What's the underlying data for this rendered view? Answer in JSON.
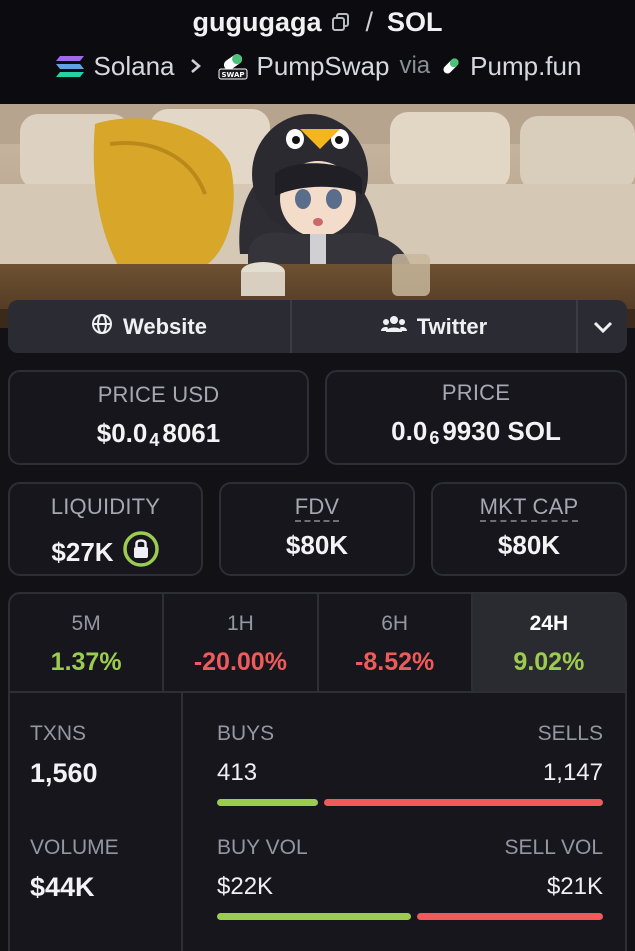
{
  "header": {
    "token_name": "gugugaga",
    "quote": "SOL",
    "chain": "Solana",
    "dex": "PumpSwap",
    "via": "via",
    "launchpad": "Pump.fun",
    "swap_badge": "SWAP"
  },
  "links": {
    "website": "Website",
    "twitter": "Twitter"
  },
  "price_usd": {
    "label": "PRICE USD",
    "prefix": "$0.0",
    "zeros": "4",
    "digits": "8061"
  },
  "price_native": {
    "label": "PRICE",
    "prefix": "0.0",
    "zeros": "6",
    "digits": "9930 SOL"
  },
  "liquidity": {
    "label": "LIQUIDITY",
    "value": "$27K"
  },
  "fdv": {
    "label": "FDV",
    "value": "$80K"
  },
  "mkt_cap": {
    "label": "MKT CAP",
    "value": "$80K"
  },
  "timeframes": [
    {
      "label": "5M",
      "change": "1.37%",
      "dir": "up"
    },
    {
      "label": "1H",
      "change": "-20.00%",
      "dir": "down"
    },
    {
      "label": "6H",
      "change": "-8.52%",
      "dir": "down"
    },
    {
      "label": "24H",
      "change": "9.02%",
      "dir": "up",
      "selected": true
    }
  ],
  "txns": {
    "label": "TXNS",
    "value": "1,560"
  },
  "volume": {
    "label": "VOLUME",
    "value": "$44K"
  },
  "buys": {
    "label": "BUYS",
    "value": "413"
  },
  "sells": {
    "label": "SELLS",
    "value": "1,147"
  },
  "buy_vol": {
    "label": "BUY VOL",
    "value": "$22K"
  },
  "sell_vol": {
    "label": "SELL VOL",
    "value": "$21K"
  },
  "buy_ratio": 0.265,
  "buy_vol_ratio": 0.51,
  "colors": {
    "positive": "#9ccc4f",
    "negative": "#f05a5a",
    "lock_ring": "#9ccc4f"
  }
}
